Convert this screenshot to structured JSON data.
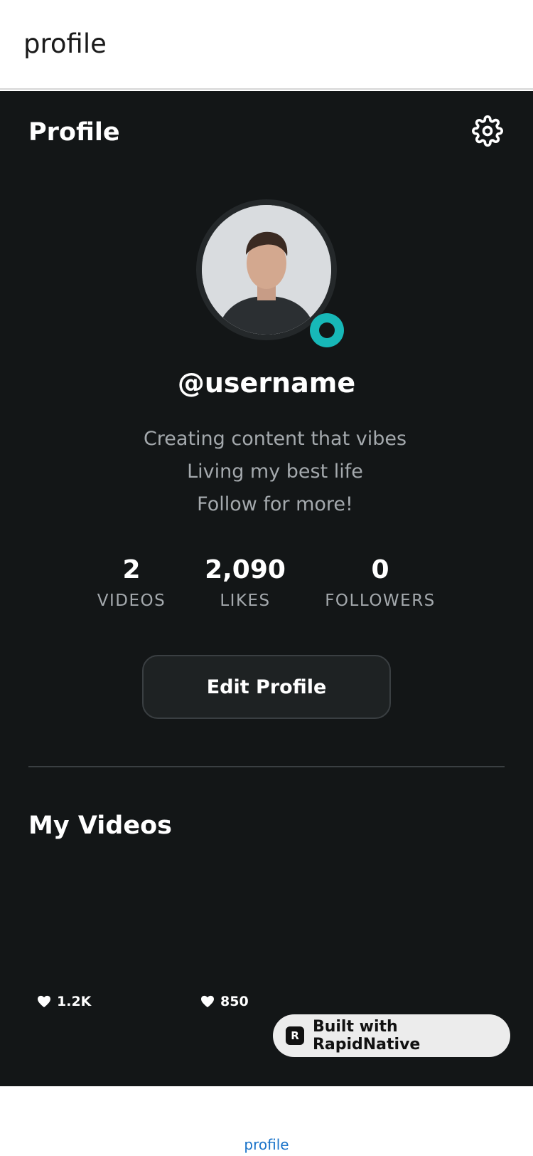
{
  "topbar": {
    "title": "profile"
  },
  "header": {
    "title": "Profile",
    "settings_icon": "gear-icon"
  },
  "profile": {
    "username": "@username",
    "bio_lines": [
      "Creating content that vibes",
      "Living my best life",
      "Follow for more!"
    ],
    "online_color": "#17b8b8"
  },
  "stats": {
    "videos": {
      "value": "2",
      "label": "VIDEOS"
    },
    "likes": {
      "value": "2,090",
      "label": "LIKES"
    },
    "followers": {
      "value": "0",
      "label": "FOLLOWERS"
    }
  },
  "actions": {
    "edit_profile_label": "Edit Profile"
  },
  "videos_section": {
    "title": "My Videos",
    "items": [
      {
        "likes": "1.2K",
        "icon": "heart-icon"
      },
      {
        "likes": "850",
        "icon": "heart-icon"
      }
    ]
  },
  "badge": {
    "label": "Built with RapidNative",
    "logo_letter": "R"
  },
  "bottom_nav": {
    "tab_label": "profile"
  },
  "colors": {
    "background": "#131617",
    "accent": "#17b8b8",
    "text_secondary": "#a4a9ad"
  }
}
